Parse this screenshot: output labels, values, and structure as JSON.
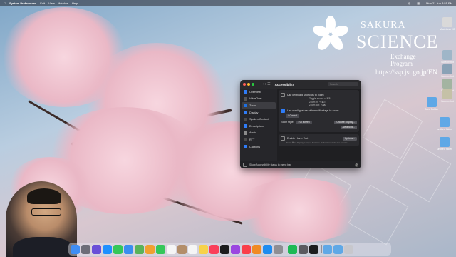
{
  "menubar": {
    "app_name": "System Preferences",
    "items": [
      "Edit",
      "View",
      "Window",
      "Help"
    ],
    "clock": "Mon 21 Jun  8:51 PM"
  },
  "wallpaper": {
    "logo_line1": "SAKURA",
    "logo_line2": "SCIENCE",
    "logo_line3": "Exchange Program",
    "url": "https://ssp.jst.go.jp/EN"
  },
  "desktop_icons": [
    {
      "label": "Macintosh HD",
      "icon": "drive-icon",
      "color": "#d9d9d9"
    },
    {
      "label": "Screenshot",
      "icon": "screenshot-icon",
      "color": "#9fb6c8"
    },
    {
      "label": "Screenshot",
      "icon": "screenshot-icon",
      "color": "#8aa2b6"
    },
    {
      "label": "Screenshot",
      "icon": "screenshot-icon",
      "color": "#a3b4a1"
    },
    {
      "label": "Screenshot",
      "icon": "screenshot-icon",
      "color": "#c5c1a7"
    },
    {
      "label": "New Folder",
      "icon": "folder-icon",
      "color": "#5fa8e6"
    },
    {
      "label": "untitled folder",
      "icon": "folder-icon",
      "color": "#5fa8e6"
    },
    {
      "label": "untitled folder",
      "icon": "folder-icon",
      "color": "#5fa8e6"
    }
  ],
  "window": {
    "title": "Accessibility",
    "search_placeholder": "Search",
    "sidebar": [
      {
        "label": "Overview",
        "color": "#2f7cf6"
      },
      {
        "label": "VoiceOver",
        "color": "#555"
      },
      {
        "label": "Zoom",
        "color": "#1e6fe0",
        "active": true
      },
      {
        "label": "Display",
        "color": "#2f7cf6"
      },
      {
        "label": "Spoken Content",
        "color": "#4a4a4a"
      },
      {
        "label": "Descriptions",
        "color": "#2f7cf6"
      },
      {
        "label": "Audio",
        "color": "#8a8a8a"
      },
      {
        "label": "RTT",
        "color": "#4a4a4a"
      },
      {
        "label": "Captions",
        "color": "#2f7cf6"
      }
    ],
    "zoom": {
      "keyboard_shortcuts_label": "Use keyboard shortcuts to zoom",
      "shortcuts": [
        {
          "name": "Toggle zoom:",
          "keys": "⌥⌘8"
        },
        {
          "name": "Zoom in:",
          "keys": "⌥⌘="
        },
        {
          "name": "Zoom out:",
          "keys": "⌥⌘-"
        }
      ],
      "scroll_gesture_label": "Use scroll gesture with modifier keys to zoom:",
      "modifier_value": "^ Control",
      "zoom_style_label": "Zoom style:",
      "zoom_style_value": "Full screen",
      "choose_display_label": "Choose Display...",
      "advanced_label": "Advanced...",
      "hover_text_label": "Enable Hover Text",
      "options_label": "Options...",
      "hover_text_hint": "Press ⌘ to display a larger font size of the item under the pointer."
    },
    "footer_label": "Show Accessibility status in menu bar",
    "help_label": "?"
  },
  "dock": {
    "icons": [
      {
        "name": "finder-icon",
        "color": "#3f8ef5"
      },
      {
        "name": "launchpad-icon",
        "color": "#6d6d78"
      },
      {
        "name": "siri-icon",
        "color": "#6a4fd8"
      },
      {
        "name": "safari-icon",
        "color": "#1e90ff"
      },
      {
        "name": "messages-icon",
        "color": "#34c759"
      },
      {
        "name": "mail-icon",
        "color": "#3a8ef0"
      },
      {
        "name": "maps-icon",
        "color": "#59b35a"
      },
      {
        "name": "photos-icon",
        "color": "#f0a030"
      },
      {
        "name": "facetime-icon",
        "color": "#34c759"
      },
      {
        "name": "calendar-icon",
        "color": "#f5f5f5"
      },
      {
        "name": "contacts-icon",
        "color": "#b38e6a"
      },
      {
        "name": "reminders-icon",
        "color": "#f5f5f5"
      },
      {
        "name": "notes-icon",
        "color": "#f7d24a"
      },
      {
        "name": "music-icon",
        "color": "#fa3f5a"
      },
      {
        "name": "tv-icon",
        "color": "#1c1c1e"
      },
      {
        "name": "podcasts-icon",
        "color": "#9b46e0"
      },
      {
        "name": "news-icon",
        "color": "#fa3f4a"
      },
      {
        "name": "books-icon",
        "color": "#f08a24"
      },
      {
        "name": "app-store-icon",
        "color": "#1e8cf0"
      },
      {
        "name": "system-preferences-icon",
        "color": "#8e8e93"
      },
      {
        "name": "spotify-icon",
        "color": "#1db954"
      },
      {
        "name": "screenshot-tool-icon",
        "color": "#5a5a60"
      },
      {
        "name": "terminal-icon",
        "color": "#1c1c1e"
      },
      {
        "name": "folder-icon",
        "color": "#5fa8e6"
      },
      {
        "name": "downloads-icon",
        "color": "#5fa8e6"
      },
      {
        "name": "trash-icon",
        "color": "#c7c7cc"
      }
    ]
  }
}
